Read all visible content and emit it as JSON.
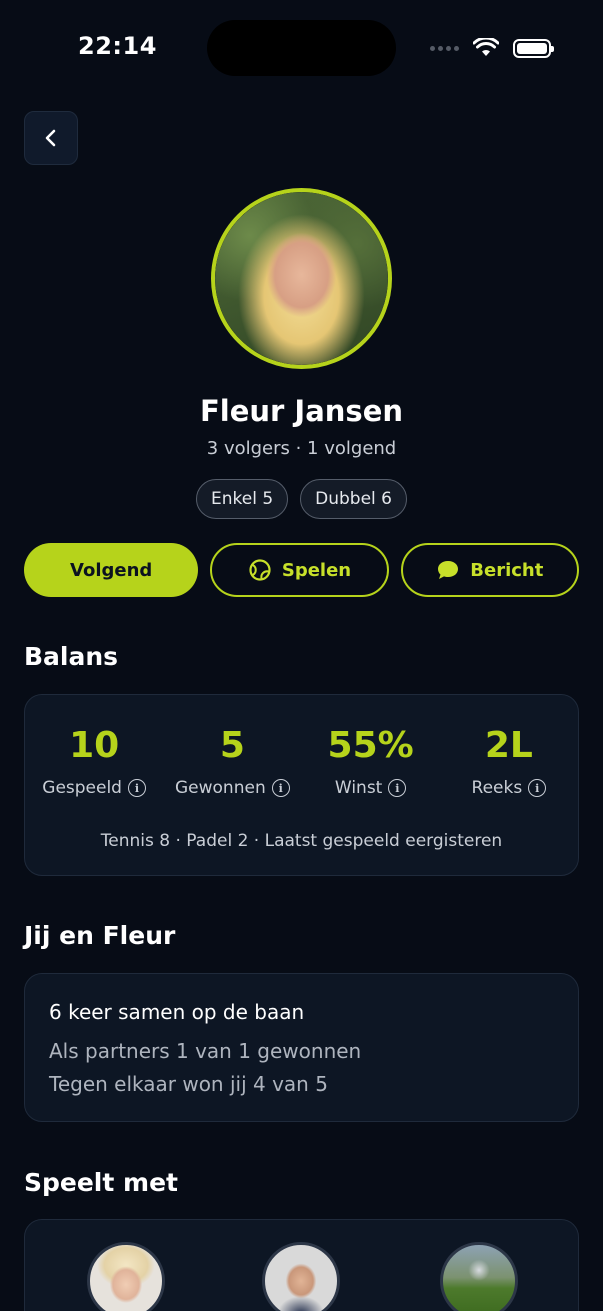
{
  "status_bar": {
    "time": "22:14"
  },
  "profile": {
    "name": "Fleur Jansen",
    "follow_info": "3 volgers · 1 volgend",
    "chips": [
      "Enkel 5",
      "Dubbel 6"
    ]
  },
  "actions": {
    "follow_label": "Volgend",
    "play_label": "Spelen",
    "message_label": "Bericht"
  },
  "balance": {
    "title": "Balans",
    "stats": [
      {
        "value": "10",
        "label": "Gespeeld"
      },
      {
        "value": "5",
        "label": "Gewonnen"
      },
      {
        "value": "55%",
        "label": "Winst"
      },
      {
        "value": "2L",
        "label": "Reeks"
      }
    ],
    "footer": "Tennis 8 · Padel 2 · Laatst gespeeld eergisteren"
  },
  "together": {
    "title": "Jij en Fleur",
    "summary": "6 keer samen op de baan",
    "partners": "Als partners 1 van 1 gewonnen",
    "opponents": "Tegen elkaar won jij 4 van 5"
  },
  "plays_with": {
    "title": "Speelt met"
  },
  "colors": {
    "accent": "#b6d31b",
    "background": "#070c16",
    "card": "#0d1624"
  }
}
